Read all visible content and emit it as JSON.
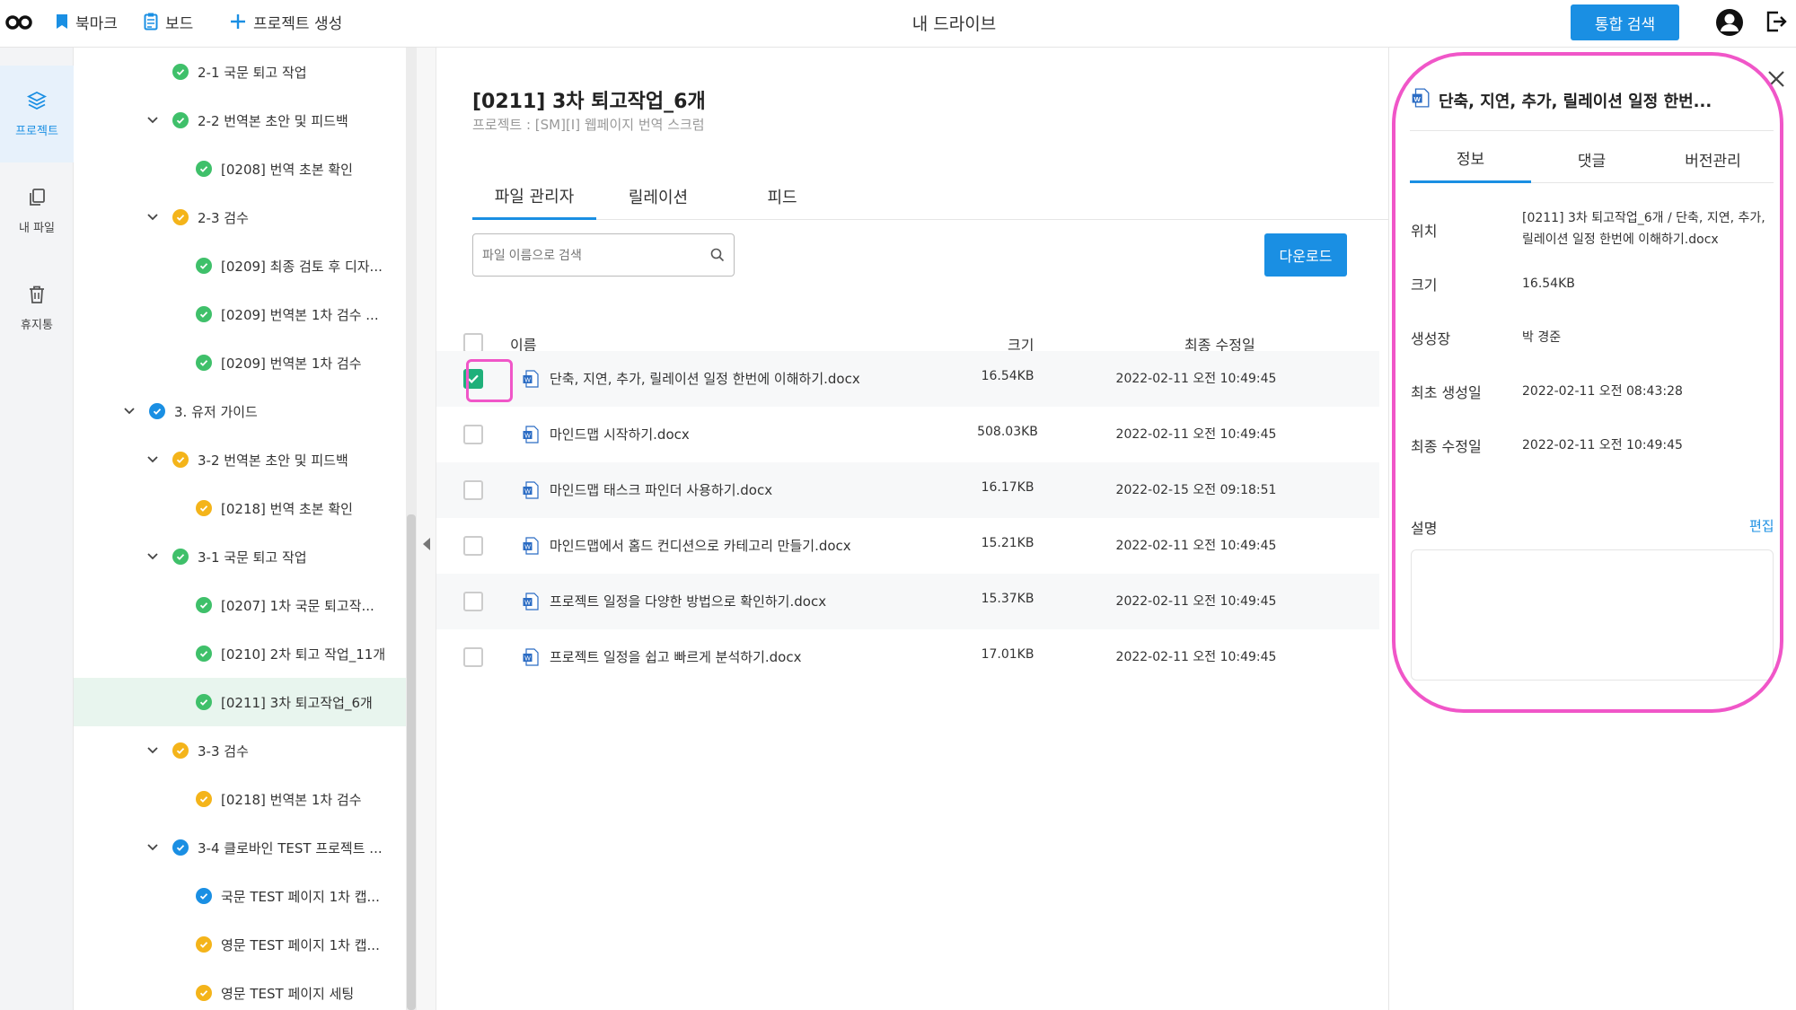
{
  "topbar": {
    "bookmark": "북마크",
    "board": "보드",
    "create_project": "프로젝트 생성",
    "heading": "내 드라이브",
    "search_all": "통합 검색"
  },
  "rail": {
    "project": "프로젝트",
    "my_files": "내 파일",
    "trash": "휴지통"
  },
  "tree": [
    {
      "label": "2-1 국문 퇴고 작업",
      "status": "green",
      "chevron": false
    },
    {
      "label": "2-2 번역본 초안 및 피드백",
      "status": "green",
      "chevron": true
    },
    {
      "label": "[0208] 번역 초본 확인",
      "status": "green",
      "chevron": false
    },
    {
      "label": "2-3 검수",
      "status": "yellow",
      "chevron": true
    },
    {
      "label": "[0209] 최종 검토 후 디자...",
      "status": "green",
      "chevron": false
    },
    {
      "label": "[0209] 번역본 1차 검수 ...",
      "status": "green",
      "chevron": false
    },
    {
      "label": "[0209] 번역본 1차 검수",
      "status": "green",
      "chevron": false
    },
    {
      "label": "3. 유저 가이드",
      "status": "blue",
      "chevron": true
    },
    {
      "label": "3-2 번역본 초안 및 피드백",
      "status": "yellow",
      "chevron": true
    },
    {
      "label": "[0218] 번역 초본 확인",
      "status": "yellow",
      "chevron": false
    },
    {
      "label": "3-1 국문 퇴고 작업",
      "status": "green",
      "chevron": true
    },
    {
      "label": "[0207] 1차 국문 퇴고작...",
      "status": "green",
      "chevron": false
    },
    {
      "label": "[0210] 2차 퇴고 작업_11개",
      "status": "green",
      "chevron": false
    },
    {
      "label": "[0211] 3차 퇴고작업_6개",
      "status": "green",
      "chevron": false
    },
    {
      "label": "3-3 검수",
      "status": "yellow",
      "chevron": true
    },
    {
      "label": "[0218] 번역본 1차 검수",
      "status": "yellow",
      "chevron": false
    },
    {
      "label": "3-4 클로바인 TEST 프로젝트 ...",
      "status": "blue",
      "chevron": true
    },
    {
      "label": "국문 TEST 페이지 1차 캡...",
      "status": "blue",
      "chevron": false
    },
    {
      "label": "영문 TEST 페이지 1차 캡...",
      "status": "yellow",
      "chevron": false
    },
    {
      "label": "영문 TEST 페이지 세팅",
      "status": "yellow",
      "chevron": false
    }
  ],
  "main": {
    "title": "[0211] 3차 퇴고작업_6개",
    "subtitle": "프로젝트 : [SM][I] 웹페이지 번역 스크럼",
    "tabs": [
      "파일 관리자",
      "릴레이션",
      "피드"
    ],
    "search_placeholder": "파일 이름으로 검색",
    "download": "다운로드",
    "columns": {
      "name": "이름",
      "size": "크기",
      "date": "최종 수정일"
    },
    "files": [
      {
        "name": "단축, 지연, 추가, 릴레이션 일정 한번에 이해하기.docx",
        "size": "16.54KB",
        "date": "2022-02-11 오전 10:49:45",
        "checked": true
      },
      {
        "name": "마인드맵 시작하기.docx",
        "size": "508.03KB",
        "date": "2022-02-11 오전 10:49:45",
        "checked": false
      },
      {
        "name": "마인드맵 태스크 파인더 사용하기.docx",
        "size": "16.17KB",
        "date": "2022-02-15 오전 09:18:51",
        "checked": false
      },
      {
        "name": "마인드맵에서 홈드 컨디션으로 카테고리 만들기.docx",
        "size": "15.21KB",
        "date": "2022-02-11 오전 10:49:45",
        "checked": false
      },
      {
        "name": "프로젝트 일정을 다양한 방법으로 확인하기.docx",
        "size": "15.37KB",
        "date": "2022-02-11 오전 10:49:45",
        "checked": false
      },
      {
        "name": "프로젝트 일정을 쉽고 빠르게 분석하기.docx",
        "size": "17.01KB",
        "date": "2022-02-11 오전 10:49:45",
        "checked": false
      }
    ]
  },
  "panel": {
    "title": "단축, 지연, 추가, 릴레이션 일정 한번...",
    "tabs": [
      "정보",
      "댓글",
      "버전관리"
    ],
    "location_label": "위치",
    "location_value": "[0211] 3차 퇴고작업_6개 / 단축, 지연, 추가, 릴레이션 일정 한번에 이해하기.docx",
    "size_label": "크기",
    "size_value": "16.54KB",
    "creator_label": "생성장",
    "creator_value": "박 경준",
    "created_label": "최초 생성일",
    "created_value": "2022-02-11 오전 08:43:28",
    "modified_label": "최종 수정일",
    "modified_value": "2022-02-11 오전 10:49:45",
    "desc_label": "설명",
    "edit": "편집"
  },
  "colors": {
    "accent": "#1a8fe3",
    "green": "#3fc06a",
    "yellow": "#f4b41a",
    "blue": "#1a8fe3",
    "highlight": "#f056c8"
  }
}
